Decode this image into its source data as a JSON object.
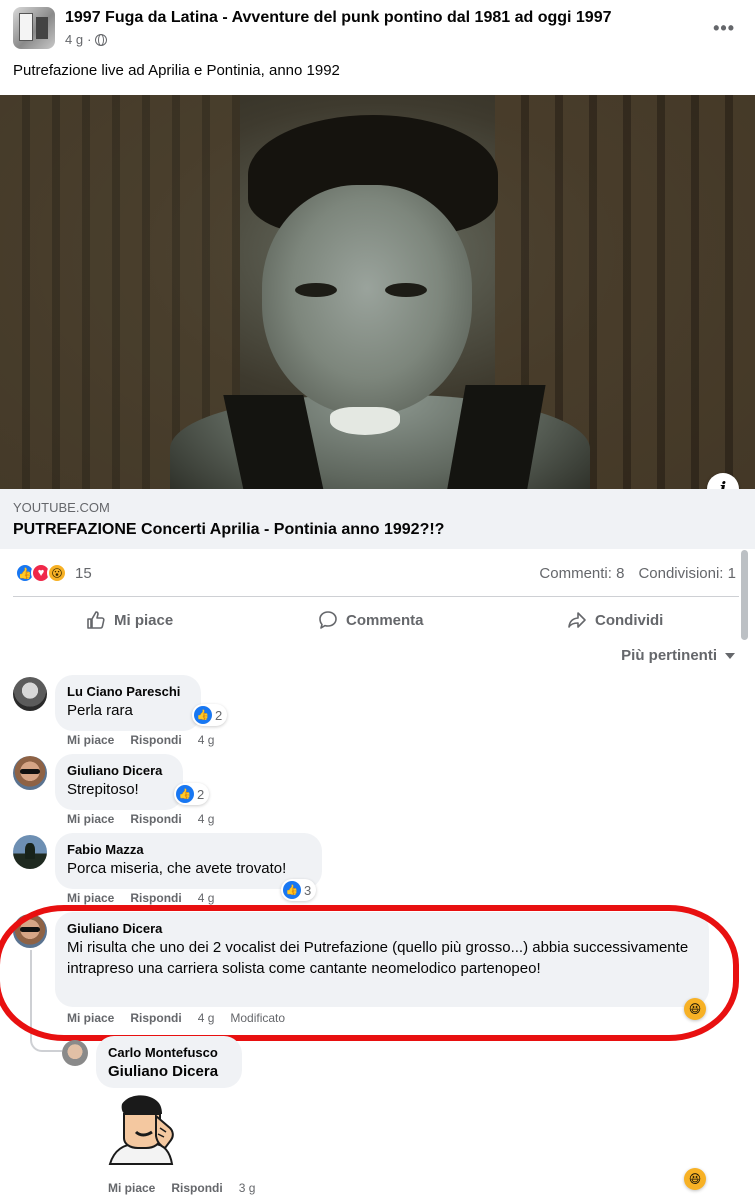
{
  "post": {
    "group_name": "1997 Fuga da Latina - Avventure del punk pontino dal 1981 ad oggi 1997",
    "time": "4 g",
    "time_sep": "·",
    "privacy_icon": "globe-icon",
    "more_label": "•••",
    "text": "Putrefazione live ad Aprilia e Pontinia, anno 1992"
  },
  "link": {
    "domain": "YOUTUBE.COM",
    "title": "PUTREFAZIONE Concerti Aprilia - Pontinia anno 1992?!?",
    "info_label": "i"
  },
  "stats": {
    "reaction_icons": [
      "like",
      "love",
      "wow"
    ],
    "reaction_count": "15",
    "comments": "Commenti: 8",
    "shares": "Condivisioni: 1"
  },
  "actions": {
    "like": "Mi piace",
    "comment": "Commenta",
    "share": "Condividi"
  },
  "sort_label": "Più pertinenti",
  "comments": [
    {
      "author": "Lu Ciano Pareschi",
      "text": "Perla rara",
      "likes": "2",
      "like_label": "Mi piace",
      "reply_label": "Rispondi",
      "time": "4 g"
    },
    {
      "author": "Giuliano Dicera",
      "text": "Strepitoso!",
      "likes": "2",
      "like_label": "Mi piace",
      "reply_label": "Rispondi",
      "time": "4 g"
    },
    {
      "author": "Fabio Mazza",
      "text": "Porca miseria, che avete trovato!",
      "likes": "3",
      "like_label": "Mi piace",
      "reply_label": "Rispondi",
      "time": "4 g"
    },
    {
      "author": "Giuliano Dicera",
      "text": "Mi risulta che uno dei 2 vocalist dei Putrefazione (quello più grosso...) abbia successivamente intrapreso una carriera solista come cantante neomelodico partenopeo!",
      "like_label": "Mi piace",
      "reply_label": "Rispondi",
      "time": "4 g",
      "edited": "Modificato",
      "reaction": "laugh"
    }
  ],
  "reply": {
    "author": "Carlo Montefusco",
    "mention": "Giuliano Dicera",
    "like_label": "Mi piace",
    "reply_label": "Rispondi",
    "time": "3 g",
    "reaction": "laugh"
  },
  "colors": {
    "accent": "#1877f2",
    "highlight": "#e81010",
    "secondary_text": "#65676b"
  }
}
